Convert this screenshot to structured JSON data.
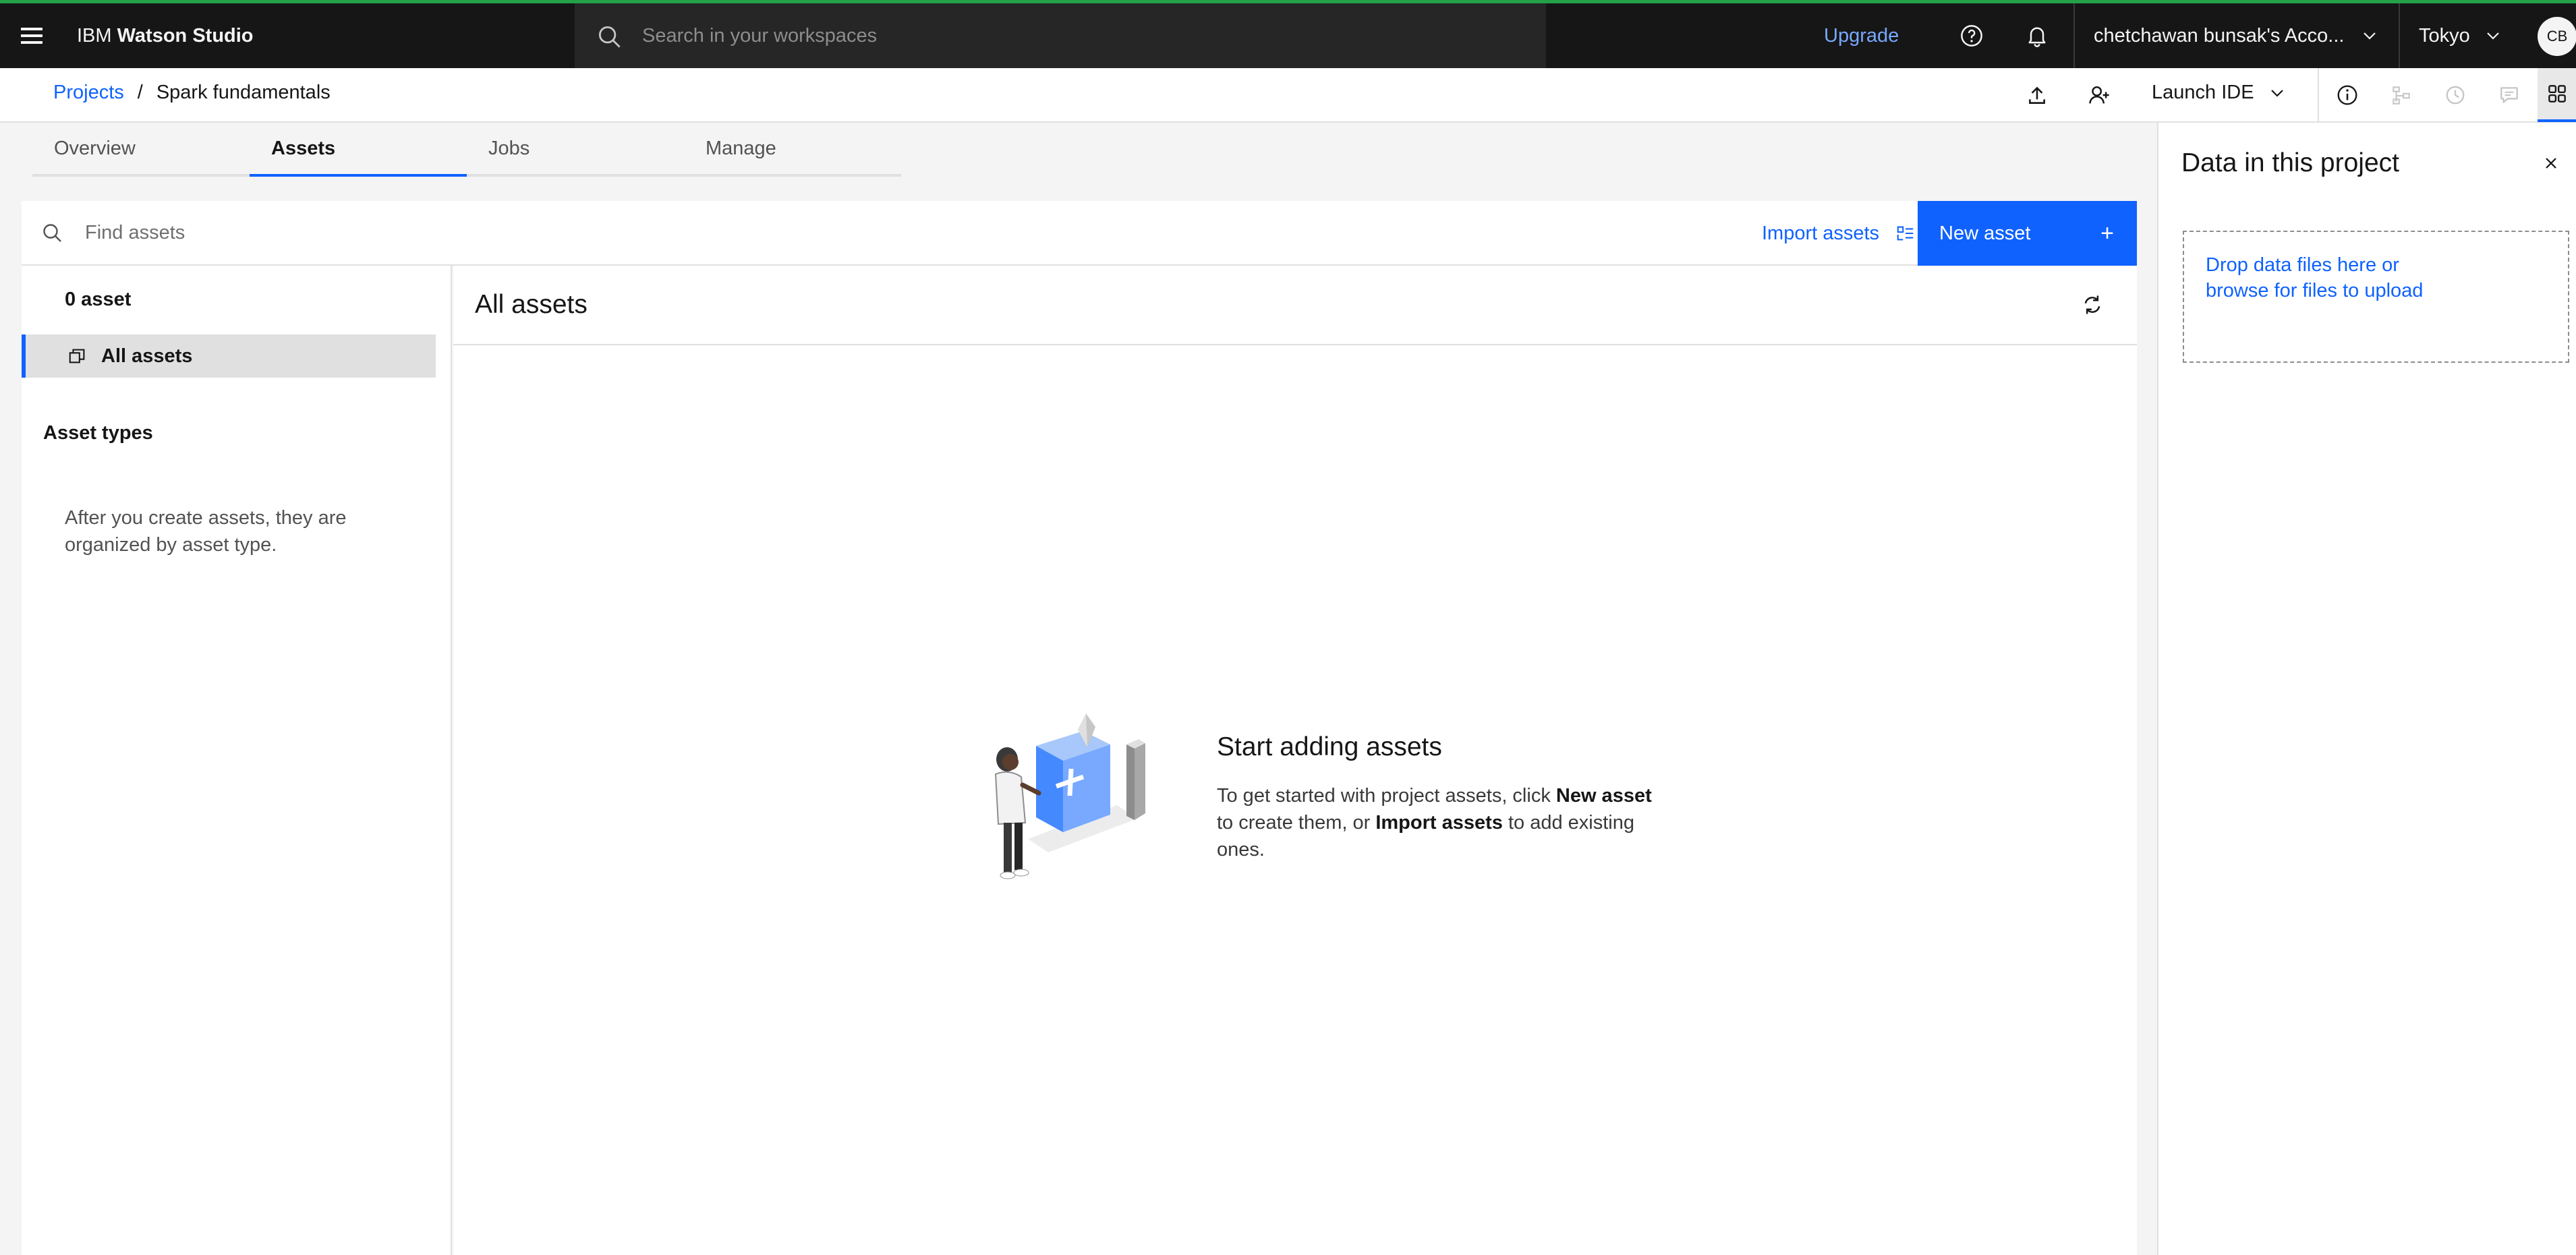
{
  "topbar": {
    "brand_prefix": "IBM ",
    "brand_name": "Watson Studio",
    "search_placeholder": "Search in your workspaces",
    "upgrade_label": "Upgrade",
    "account_label": "chetchawan bunsak's Acco...",
    "region_label": "Tokyo",
    "avatar_initials": "CB"
  },
  "project": {
    "breadcrumb_root": "Projects",
    "breadcrumb_sep": "/",
    "name": "Spark fundamentals",
    "launch_ide_label": "Launch IDE"
  },
  "tabs": [
    {
      "label": "Overview",
      "active": false
    },
    {
      "label": "Assets",
      "active": true
    },
    {
      "label": "Jobs",
      "active": false
    },
    {
      "label": "Manage",
      "active": false
    }
  ],
  "assets_toolbar": {
    "search_placeholder": "Find assets",
    "import_label": "Import assets",
    "new_asset_label": "New asset",
    "new_asset_icon": "+"
  },
  "sidebar": {
    "asset_count": "0 asset",
    "all_assets_label": "All assets",
    "asset_types_heading": "Asset types",
    "asset_types_hint": "After you create assets, they are organized by asset type."
  },
  "main": {
    "title": "All assets",
    "empty_title": "Start adding assets",
    "empty_text_1": "To get started with project assets, click ",
    "empty_text_new": "New asset",
    "empty_text_2": " to create them, or ",
    "empty_text_import": "Import assets",
    "empty_text_3": " to add existing ones."
  },
  "right_panel": {
    "title": "Data in this project",
    "dropzone_line1": "Drop data files here or",
    "dropzone_line2": "browse for files to upload"
  },
  "colors": {
    "accent": "#0f62fe",
    "topbar_bg": "#161616",
    "topbar_stripe": "#24a148"
  },
  "icons": [
    "menu-icon",
    "search-icon",
    "help-icon",
    "notification-icon",
    "chevron-down-icon",
    "upload-icon",
    "add-collaborator-icon",
    "info-icon",
    "lineage-icon",
    "history-icon",
    "comment-icon",
    "data-panel-icon",
    "import-icon",
    "add-icon",
    "asset-stack-icon",
    "refresh-icon",
    "close-icon"
  ]
}
